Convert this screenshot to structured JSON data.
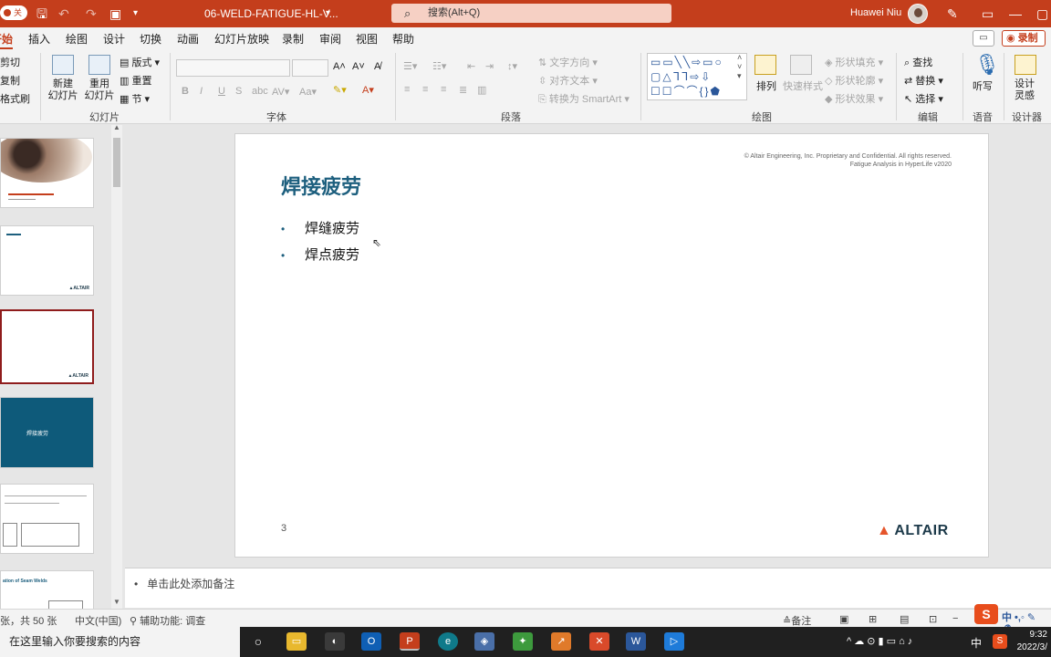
{
  "titlebar": {
    "autosave": "关",
    "doc_title": "06-WELD-FATIGUE-HL-V...",
    "search_placeholder": "搜索(Alt+Q)",
    "user_name": "Huawei Niu",
    "accent": "#c43e1c"
  },
  "tabs": [
    "开始",
    "插入",
    "绘图",
    "设计",
    "切换",
    "动画",
    "幻灯片放映",
    "录制",
    "审阅",
    "视图",
    "帮助"
  ],
  "record_label": "录制",
  "ribbon": {
    "clipboard": {
      "cut": "剪切",
      "copy": "复制",
      "format_painter": "格式刷"
    },
    "slides": {
      "new_slide": "新建\n幻灯片",
      "reuse_slide": "重用\n幻灯片",
      "layout": "版式",
      "reset": "重置",
      "section": "节",
      "label": "幻灯片"
    },
    "font": {
      "label": "字体",
      "bold": "B",
      "italic": "I",
      "underline": "U",
      "strike": "S"
    },
    "paragraph": {
      "text_direction": "文字方向",
      "align_text": "对齐文本",
      "smartart": "转换为 SmartArt",
      "label": "段落"
    },
    "drawing": {
      "arrange": "排列",
      "quick_styles": "快速样式",
      "shape_fill": "形状填充",
      "shape_outline": "形状轮廓",
      "shape_effects": "形状效果",
      "label": "绘图"
    },
    "editing": {
      "find": "查找",
      "replace": "替换",
      "select": "选择",
      "label": "编辑"
    },
    "voice": {
      "dictate": "听写",
      "label": "语音"
    },
    "designer": {
      "ideas": "设计\n灵感",
      "label": "设计器"
    }
  },
  "slide": {
    "title": "焊接疲劳",
    "copyright_line1": "© Altair Engineering, Inc. Proprietary and Confidential. All rights reserved.",
    "copyright_line2": "Fatigue Analysis in HyperLife  v2020",
    "bullets": [
      "焊缝疲劳",
      "焊点疲劳"
    ],
    "page_number": "3",
    "logo": "ALTAIR"
  },
  "notes_placeholder": "单击此处添加备注",
  "statusbar": {
    "slide_count": "张，共 50 张",
    "language": "中文(中国)",
    "accessibility": "辅助功能: 调查",
    "notes": "备注"
  },
  "taskbar": {
    "search_placeholder": "在这里输入你要搜索的内容",
    "time": "9:32",
    "date": "2022/3/",
    "ime": "中"
  },
  "thumbnails": {
    "thumb4_title": "焊接疲劳",
    "thumb6_title": "ation of Seam Welds"
  }
}
